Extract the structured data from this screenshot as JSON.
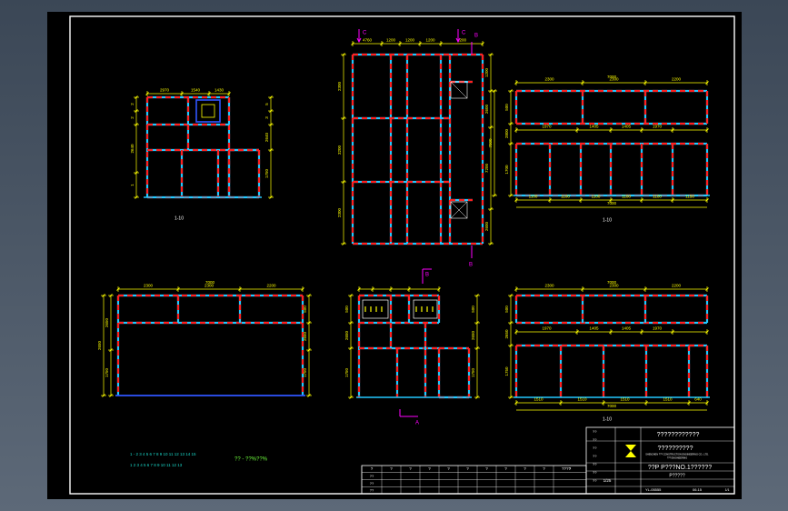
{
  "colors": {
    "background": "#000000",
    "frame": "#ffffff",
    "frame_red": "#ff2020",
    "frame_cyan": "#22c8ff",
    "dimension": "#ffff00",
    "section_marker": "#ff00ff",
    "fill_blue": "#2f55ff",
    "text_teal": "#19d7c8",
    "text_green": "#6eff3c"
  },
  "views": {
    "top_left": {
      "dims_top": [
        "2970",
        "1540",
        "1430"
      ],
      "dims_left": [
        "2",
        "2",
        "2640",
        "1"
      ],
      "dims_right": [
        "5",
        "3",
        "2640",
        "1750"
      ],
      "label": "1-10"
    },
    "top_middle": {
      "section_markers": [
        "C",
        "C",
        "B",
        "B"
      ],
      "dims_top": [
        "4760",
        "1200",
        "1200",
        "1200",
        "1200"
      ],
      "dims_left": [
        "2300",
        "3200",
        "2300"
      ],
      "dims_right": [
        "1200",
        "2600",
        "7200",
        "2600"
      ]
    },
    "top_right": {
      "dims_top": [
        "7000",
        "2300",
        "2300",
        "2200"
      ],
      "dims_mid": [
        "1970",
        "1405",
        "1405",
        "1970"
      ],
      "dims_bottom": [
        "1100",
        "1100",
        "1100",
        "1100",
        "1100",
        "1150"
      ],
      "dims_total": "7000",
      "dims_left": [
        "500",
        "2800",
        "1700"
      ],
      "dims_right": [
        "7000"
      ],
      "label": "1-10"
    },
    "bottom_left": {
      "dims_top": [
        "7000",
        "2300",
        "2300",
        "2200"
      ],
      "dims_left": [
        "2650",
        "500",
        "1750"
      ],
      "dims_right": [
        "500",
        "2650",
        "1750"
      ]
    },
    "bottom_middle": {
      "section_markers": [
        "B",
        "A"
      ],
      "dims_left": [
        "500",
        "2650",
        "1750"
      ],
      "dims_right": [
        "500",
        "2650",
        "1750"
      ]
    },
    "bottom_right": {
      "dims_top": [
        "7000",
        "2300",
        "2300",
        "2200"
      ],
      "dims_mid": [
        "1970",
        "1405",
        "1405",
        "1970"
      ],
      "dims_bottom": [
        "1510",
        "1510",
        "1510",
        "1510",
        "640"
      ],
      "dims_total": "7000",
      "dims_left": [
        "500",
        "2650",
        "1750"
      ],
      "label": "1-10"
    }
  },
  "notes": {
    "line1": "1 - 2 3 4 5 6 7 8 9 10 11 12 13 14 15",
    "line2": "1 2 3 4 5 6 7 8 9 10 11 12 13",
    "handwritten": "?? - ??%??%"
  },
  "title_block": {
    "company": "????????????",
    "subtitle": "??????????",
    "small_text_1": "SHENZHEN ??? CONSTRUCTION ENGINEERING CO., LTD.",
    "small_text_2": "??? ENGINEERING",
    "drawing_name": "??P P???NO.1??????",
    "sub_name": "P?????",
    "drawing_no": "YL-05555",
    "date": "06.15",
    "scale": "1/25",
    "sheet": "1/1",
    "rev_cols": [
      "?",
      "?",
      "?",
      "?",
      "?",
      "?",
      "?",
      "?",
      "?",
      "?",
      "?",
      "?",
      "????"
    ],
    "rev_rows": [
      "??",
      "??",
      "??"
    ],
    "left_labels": [
      "??",
      "??",
      "??",
      "??",
      "??",
      "??",
      "??"
    ]
  }
}
